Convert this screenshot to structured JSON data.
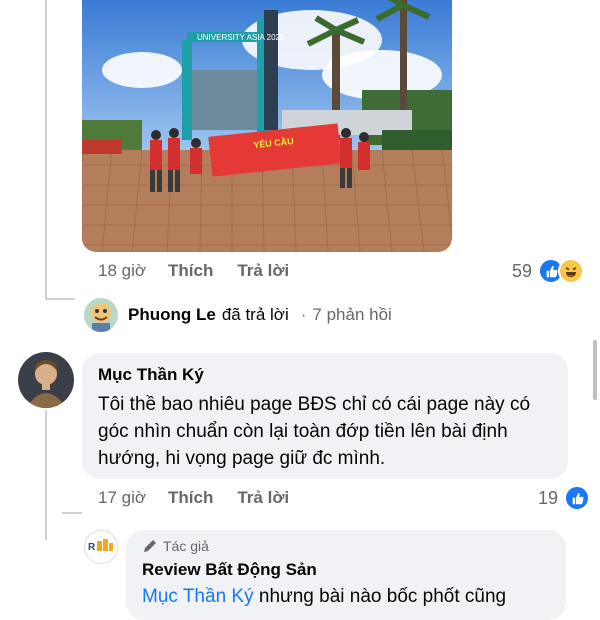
{
  "first_comment": {
    "time": "18 giờ",
    "like_label": "Thích",
    "reply_label": "Trả lời",
    "reaction_count": "59",
    "reactions": [
      "like-icon",
      "haha-icon"
    ]
  },
  "reply_summary": {
    "name": "Phuong Le",
    "action": "đã trả lời",
    "separator": "·",
    "count_text": "7 phản hồi"
  },
  "comment": {
    "author": "Mục Thần Ký",
    "text": "Tôi thề bao nhiêu page BĐS chỉ có cái page này có góc nhìn chuẩn còn lại toàn đớp tiền lên bài định hướng, hi vọng page giữ đc mình.",
    "time": "17 giờ",
    "like_label": "Thích",
    "reply_label": "Trả lời",
    "reaction_count": "19"
  },
  "reply": {
    "badge": "Tác giả",
    "author": "Review Bất Động Sản",
    "mention": "Mục Thần Ký",
    "text": " nhưng bài nào bốc phốt cũng"
  },
  "photo": {
    "banner_text": "YÊU CẦU",
    "gate_text": "UNIVERSITY ASIA 2025"
  },
  "colors": {
    "accent": "#1877f2",
    "muted": "#65676b",
    "bubble": "#f0f2f5"
  }
}
